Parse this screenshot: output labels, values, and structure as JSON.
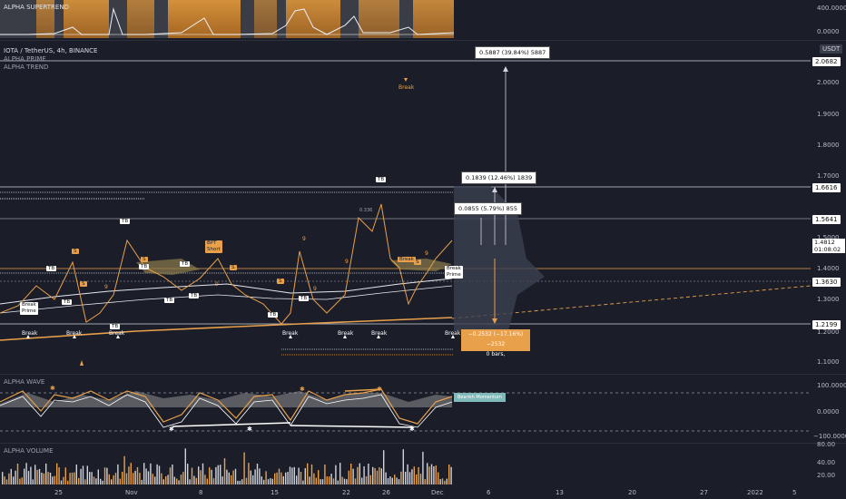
{
  "top_panel": {
    "label": "ALPHA SUPERTREND",
    "ticks": [
      "400.0000",
      "0.0000"
    ]
  },
  "main": {
    "symbol_title": "IOTA / TetherUS, 4h, BINANCE",
    "indicator1": "ALPHA PRIME",
    "indicator2": "ALPHA TREND",
    "currency": "USDT",
    "price_ticks": [
      "2.0000",
      "1.9000",
      "1.8000",
      "1.7000",
      "1.5000",
      "1.4000",
      "1.3000",
      "1.2000",
      "1.1000"
    ],
    "tags": {
      "top": "2.0682",
      "upper": "1.6616",
      "mid_high": "1.5641",
      "last": "1.4812",
      "countdown": "01:08:02",
      "mid_low": "1.3630",
      "low": "1.2199"
    },
    "callouts": {
      "top": "0.5887 (39.84%) 5887",
      "mid": "0.1839 (12.46%) 1839",
      "low": "0.0855 (5.79%) 855",
      "down_line1": "−0.2532 (−17.16%) −2532",
      "down_line2": "0 bars,"
    },
    "break_labels": [
      "Break",
      "Break",
      "Break",
      "Break",
      "Break",
      "Break",
      "Break"
    ],
    "break_top": "Break",
    "break_prime_left": "Break\nPrime",
    "break_prime_right": "Break\nPrime",
    "tb_tags": [
      "TB",
      "TB",
      "TB",
      "TB",
      "TB",
      "TB",
      "TB",
      "TB",
      "TB",
      "TB",
      "TB"
    ],
    "s_tags": [
      "S",
      "S",
      "S",
      "S",
      "S",
      "S"
    ],
    "bpt_short": "BPT\nShort",
    "nines": [
      "9",
      "9",
      "9",
      "9",
      "9",
      "9"
    ],
    "small_value": "0.336"
  },
  "wave": {
    "label": "ALPHA WAVE",
    "ticks": [
      "100.0000",
      "0.0000",
      "−100.0000"
    ],
    "badge": "Bearish Momentum"
  },
  "volume": {
    "label": "ALPHA VOLUME",
    "ticks": [
      "80.00",
      "40.00",
      "20.00"
    ]
  },
  "time_axis": [
    "25",
    "Nov",
    "8",
    "15",
    "22",
    "26",
    "Dec",
    "6",
    "13",
    "20",
    "27",
    "2022",
    "5"
  ],
  "colors": {
    "orange": "#e8a04a",
    "white": "#ffffff",
    "bg": "#1b1e29"
  }
}
